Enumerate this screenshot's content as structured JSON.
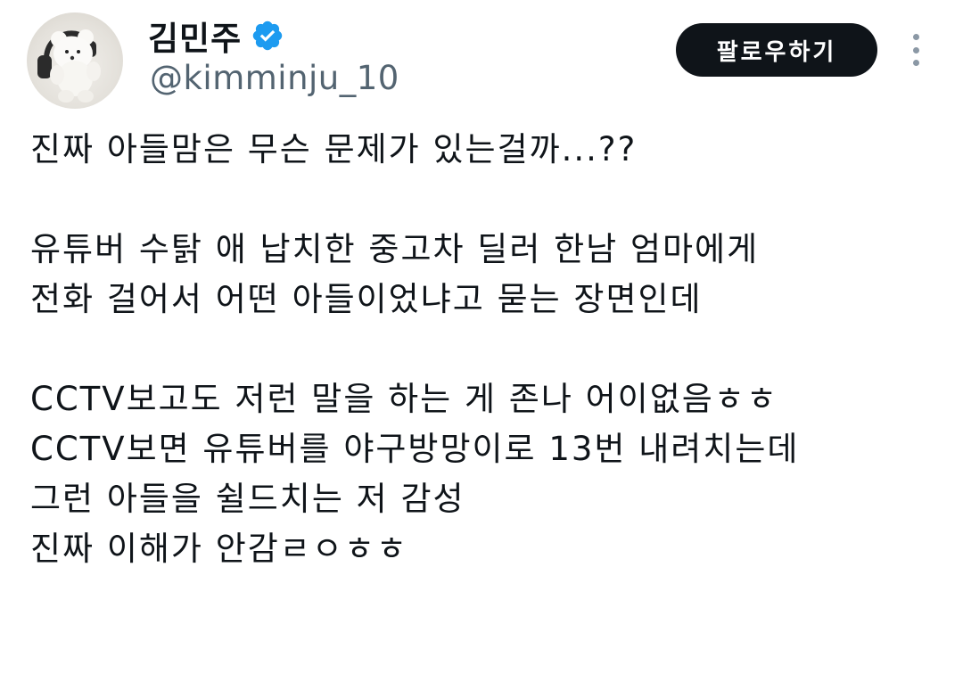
{
  "profile": {
    "display_name": "김민주",
    "handle": "@kimminju_10",
    "verified": true,
    "avatar": "teddy-bear-with-headphones-photo"
  },
  "actions": {
    "follow_label": "팔로우하기",
    "more_icon": "vertical-ellipsis-icon"
  },
  "colors": {
    "verified_badge": "#1d9bf0",
    "follow_button_bg": "#0f1419",
    "handle_text": "#536471"
  },
  "tweet": {
    "lines": [
      "진짜 아들맘은 무슨 문제가 있는걸까...??",
      "",
      "유튜버 수탉 애 납치한 중고차 딜러 한남 엄마에게",
      "전화 걸어서 어떤 아들이었냐고 묻는 장면인데",
      "",
      "CCTV보고도 저런 말을 하는 게 존나 어이없음ㅎㅎ",
      "CCTV보면 유튜버를 야구방망이로 13번 내려치는데",
      "그런 아들을 쉴드치는 저 감성",
      "진짜 이해가 안감ㄹㅇㅎㅎ"
    ]
  }
}
